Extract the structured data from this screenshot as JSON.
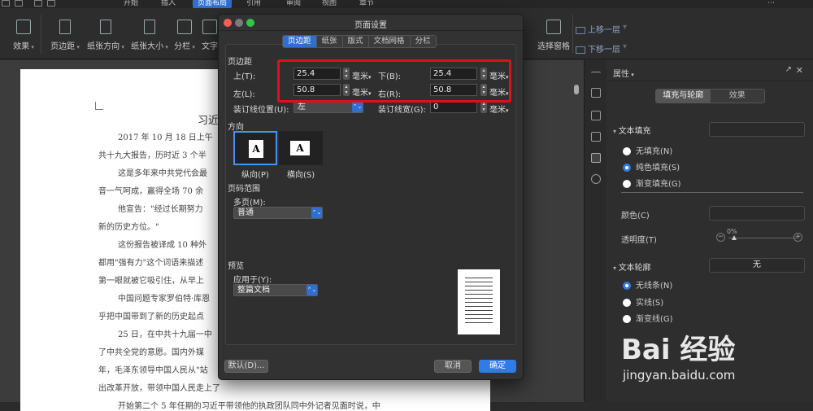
{
  "menubar": {
    "tabs": [
      "开始",
      "插入",
      "页面布局",
      "引用",
      "审阅",
      "视图",
      "章节"
    ],
    "active": "页面布局"
  },
  "ribbon": {
    "buttons": [
      "效果",
      "页边距",
      "纸张方向",
      "纸张大小",
      "分栏",
      "文字"
    ],
    "right_buttons": [
      "选择窗格"
    ],
    "small": [
      "上移一层",
      "下移一层"
    ]
  },
  "document": {
    "title": "习近",
    "lines": [
      "2017 年 10 月 18 日上午",
      "共十九大报告，历时近 3 个半",
      "这是多年来中共党代会最",
      "音一气呵成，赢得全场 70 余",
      "他宣告：\"经过长期努力",
      "新的历史方位。\"",
      "这份报告被译成 10 种外",
      "都用\"强有力\"这个词语来描述",
      "第一眼就被它吸引住，从早上",
      "中国问题专家罗伯特·库恩",
      "乎把中国带到了新的历史起点",
      "25 日，在中共十九届一中",
      "了中共全党的意愿。国内外媒",
      "年，毛泽东领导中国人民从\"站",
      "出改革开放，带领中国人民走上了",
      "开始第二个 5 年任期的习近平带领他的执政团队同中外记者见面时说，中"
    ]
  },
  "panel": {
    "title": "属性",
    "tabs": [
      "填充与轮廓",
      "效果"
    ],
    "fill_section": "文本填充",
    "fill_options": [
      "无填充(N)",
      "纯色填充(S)",
      "渐变填充(G)"
    ],
    "color_label": "颜色(C)",
    "transparency_label": "透明度(T)",
    "transparency_value": "0%",
    "outline_section": "文本轮廓",
    "outline_value": "无",
    "outline_options": [
      "无线条(N)",
      "实线(S)",
      "渐变线(G)"
    ]
  },
  "dialog": {
    "title": "页面设置",
    "tabs": [
      "页边距",
      "纸张",
      "版式",
      "文档网格",
      "分栏"
    ],
    "active_tab": "页边距",
    "margins_heading": "页边距",
    "top_label": "上(T):",
    "top_value": "25.4",
    "bottom_label": "下(B):",
    "bottom_value": "25.4",
    "left_label": "左(L):",
    "left_value": "50.8",
    "right_label": "右(R):",
    "right_value": "50.8",
    "unit": "毫米",
    "gutter_pos_label": "装订线位置(U):",
    "gutter_pos_value": "左",
    "gutter_width_label": "装订线宽(G):",
    "gutter_width_value": "0",
    "orientation_heading": "方向",
    "portrait_label": "纵向(P)",
    "landscape_label": "横向(S)",
    "page_range_heading": "页码范围",
    "multi_page_label": "多页(M):",
    "multi_page_value": "普通",
    "preview_heading": "预览",
    "apply_label": "应用于(Y):",
    "apply_value": "整篇文档",
    "default_button": "默认(D)...",
    "cancel_button": "取消",
    "ok_button": "确定"
  },
  "watermark": {
    "brand": "Bai 经验",
    "url": "jingyan.baidu.com"
  },
  "colors": {
    "accent": "#2f6fd0",
    "highlight": "#e0101a"
  }
}
